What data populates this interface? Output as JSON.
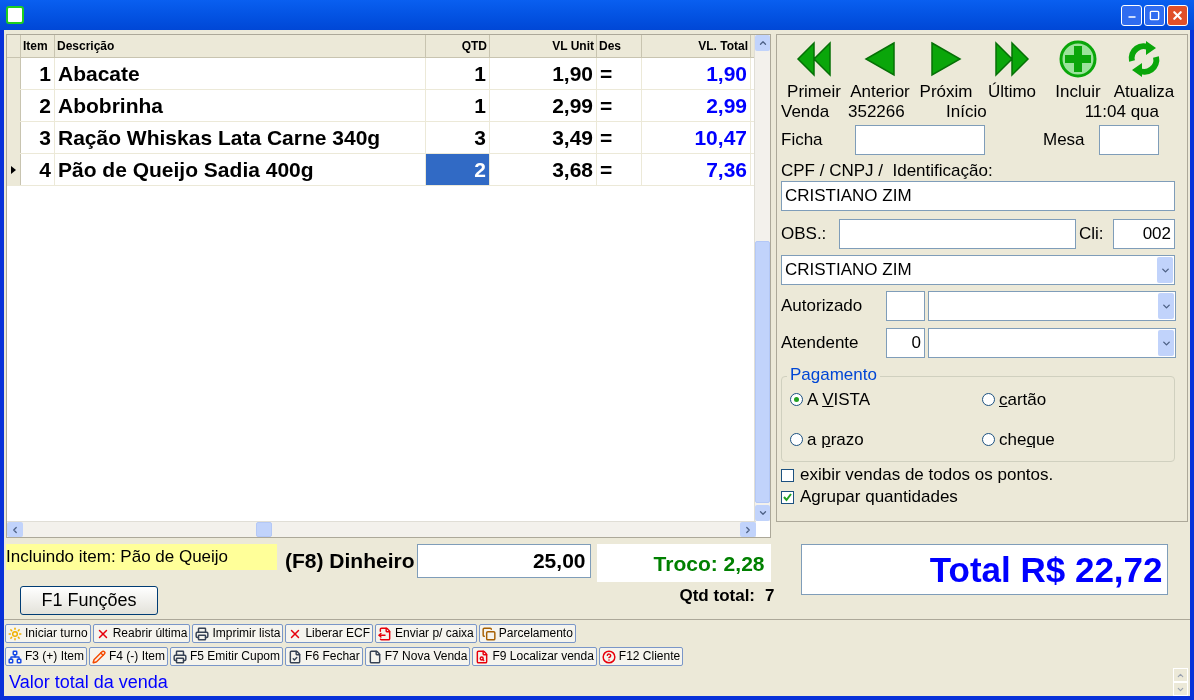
{
  "grid": {
    "columns": [
      {
        "label": "Item"
      },
      {
        "label": "Descrição"
      },
      {
        "label": "QTD"
      },
      {
        "label": "VL Unit"
      },
      {
        "label": "Des"
      },
      {
        "label": "VL. Total"
      }
    ],
    "rows": [
      {
        "item": "1",
        "description": "Abacate",
        "qtd": "1",
        "unit": "1,90",
        "discount": "=",
        "total": "1,90",
        "selected": false
      },
      {
        "item": "2",
        "description": "Abobrinha",
        "qtd": "1",
        "unit": "2,99",
        "discount": "=",
        "total": "2,99",
        "selected": false
      },
      {
        "item": "3",
        "description": "Ração Whiskas Lata Carne 340g",
        "qtd": "3",
        "unit": "3,49",
        "discount": "=",
        "total": "10,47",
        "selected": false
      },
      {
        "item": "4",
        "description": "Pão de Queijo Sadia 400g",
        "qtd": "2",
        "unit": "3,68",
        "discount": "=",
        "total": "7,36",
        "selected": true
      }
    ]
  },
  "nav_buttons": [
    {
      "label": "Primeir"
    },
    {
      "label": "Anterior"
    },
    {
      "label": "Próxim"
    },
    {
      "label": "Último"
    },
    {
      "label": "Incluir"
    },
    {
      "label": "Atualiza"
    }
  ],
  "info": {
    "venda_label": "Venda",
    "venda_number": "352266",
    "stage": "Início",
    "clock": "11:04 qua"
  },
  "ficha": {
    "label": "Ficha"
  },
  "mesa": {
    "label": "Mesa"
  },
  "identificacao": {
    "label": "CPF / CNPJ /  Identificação:",
    "value": "CRISTIANO ZIM"
  },
  "obs": {
    "label": "OBS.:"
  },
  "cli": {
    "label": "Cli:",
    "value": "002"
  },
  "client_select": {
    "value": "CRISTIANO ZIM"
  },
  "autorizado": {
    "label": "Autorizado"
  },
  "atendente": {
    "label": "Atendente",
    "code": "0"
  },
  "payment": {
    "title": "Pagamento",
    "options": [
      {
        "before": "A ",
        "hotkey": "V",
        "after": "ISTA",
        "selected": true
      },
      {
        "hotkey": "c",
        "after": "artão",
        "selected": false
      },
      {
        "before": "a ",
        "hotkey": "p",
        "after": "razo",
        "selected": false
      },
      {
        "before": "che",
        "hotkey": "q",
        "after": "ue",
        "selected": false
      }
    ]
  },
  "checkboxes": [
    {
      "label": "exibir vendas de todos os pontos.",
      "checked": false
    },
    {
      "label": "Agrupar quantidades",
      "checked": true
    }
  ],
  "status_message": "Incluindo item: Pão de Queijo",
  "functions_button": "F1 Funções",
  "cash": {
    "label": "(F8) Dinheiro",
    "value": "25,00"
  },
  "change": "Troco: 2,28",
  "qty_total": {
    "label": "Qtd total:",
    "value": "7"
  },
  "total": "Total R$ 22,72",
  "toolbar_rows": [
    [
      "Iniciar turno",
      "Reabrir última",
      "Imprimir lista",
      "Liberar ECF",
      "Enviar p/ caixa",
      "Parcelamento"
    ],
    [
      "F3 (+) Item",
      "F4 (-) Item",
      "F5 Emitir Cupom",
      "F6 Fechar",
      "F7 Nova Venda",
      "F9 Localizar venda",
      "F12 Cliente"
    ]
  ],
  "status_bar": "Valor total da venda"
}
